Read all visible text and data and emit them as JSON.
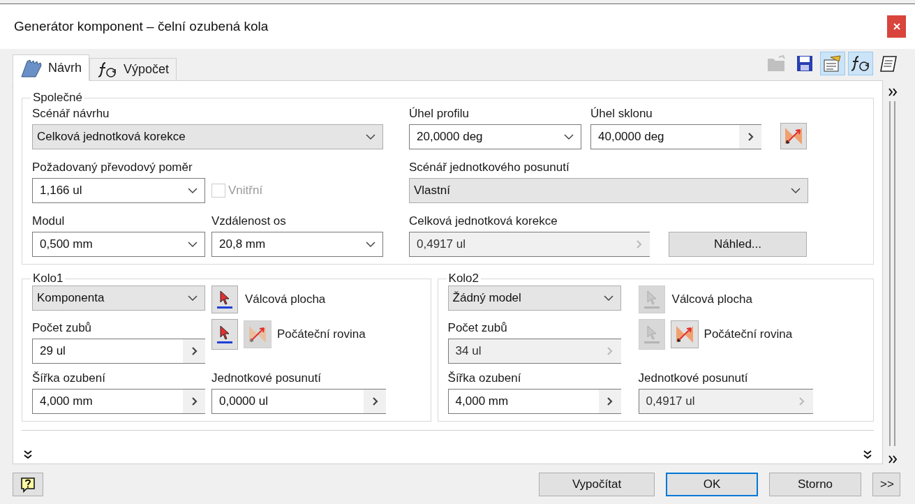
{
  "window": {
    "title": "Generátor komponent – čelní ozubená kola"
  },
  "tabs": [
    {
      "label": "Návrh",
      "kind": "design",
      "selected": true
    },
    {
      "label": "Výpočet",
      "kind": "calc",
      "selected": false
    }
  ],
  "toolbar": [
    {
      "kind": "open",
      "disabled": true,
      "pressed": false
    },
    {
      "kind": "save",
      "disabled": false,
      "pressed": false
    },
    {
      "kind": "options",
      "disabled": false,
      "pressed": true
    },
    {
      "kind": "formula",
      "disabled": false,
      "pressed": true
    },
    {
      "kind": "notes",
      "disabled": false,
      "pressed": false
    }
  ],
  "common": {
    "title": "Společné",
    "design_scenario": {
      "label": "Scénář návrhu",
      "value": "Celková jednotková korekce",
      "kind": "select",
      "disabled": false
    },
    "gear_ratio": {
      "label": "Požadovaný převodový poměr",
      "value": "1,166 ul",
      "kind": "combo",
      "disabled": false
    },
    "internal": {
      "label": "Vnitřní",
      "checked": false,
      "disabled": true
    },
    "module": {
      "label": "Modul",
      "value": "0,500 mm",
      "kind": "combo",
      "disabled": false
    },
    "center_distance": {
      "label": "Vzdálenost os",
      "value": "20,8 mm",
      "kind": "combo",
      "disabled": false
    },
    "pressure_angle": {
      "label": "Úhel profilu",
      "value": "20,0000 deg",
      "kind": "combo",
      "disabled": false
    },
    "helix_angle": {
      "label": "Úhel sklonu",
      "value": "40,0000 deg",
      "kind": "spin",
      "disabled": false
    },
    "shift_scenario": {
      "label": "Scénář jednotkového posunutí",
      "value": "Vlastní",
      "kind": "select",
      "disabled": false
    },
    "total_correction": {
      "label": "Celková jednotková korekce",
      "value": "0,4917 ul",
      "kind": "spin",
      "disabled": true
    },
    "preview_button": "Náhled..."
  },
  "gears": [
    {
      "title": "Kolo1",
      "model": {
        "value": "Komponenta",
        "kind": "select",
        "disabled": false
      },
      "cylindrical_face": {
        "label": "Válcová plocha",
        "enabled": true
      },
      "start_plane": {
        "label": "Počáteční rovina",
        "enabled": true
      },
      "teeth": {
        "label": "Počet zubů",
        "value": "29 ul",
        "kind": "spin",
        "disabled": false
      },
      "face_width": {
        "label": "Šířka ozubení",
        "value": "4,000 mm",
        "kind": "spin",
        "disabled": false
      },
      "unit_shift": {
        "label": "Jednotkové posunutí",
        "value": "0,0000 ul",
        "kind": "spin",
        "disabled": false
      }
    },
    {
      "title": "Kolo2",
      "model": {
        "value": "Žádný model",
        "kind": "select",
        "disabled": false
      },
      "cylindrical_face": {
        "label": "Válcová plocha",
        "enabled": false
      },
      "start_plane": {
        "label": "Počáteční rovina",
        "enabled": false
      },
      "teeth": {
        "label": "Počet zubů",
        "value": "34 ul",
        "kind": "spin",
        "disabled": true
      },
      "face_width": {
        "label": "Šířka ozubení",
        "value": "4,000 mm",
        "kind": "spin",
        "disabled": false
      },
      "unit_shift": {
        "label": "Jednotkové posunutí",
        "value": "0,4917 ul",
        "kind": "spin",
        "disabled": true
      }
    }
  ],
  "buttons": [
    {
      "label": "Vypočítat",
      "default": false
    },
    {
      "label": "OK",
      "default": true
    },
    {
      "label": "Storno",
      "default": false
    },
    {
      "label": ">>",
      "default": false
    }
  ]
}
